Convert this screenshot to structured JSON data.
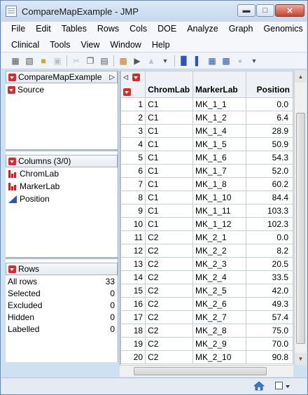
{
  "window": {
    "title": "CompareMapExample - JMP"
  },
  "menus": {
    "row1": [
      "File",
      "Edit",
      "Tables",
      "Rows",
      "Cols",
      "DOE",
      "Analyze",
      "Graph",
      "Genomics"
    ],
    "row2": [
      "Clinical",
      "Tools",
      "View",
      "Window",
      "Help"
    ]
  },
  "toolbar": [
    "new-table-icon",
    "open-icon",
    "folder-icon",
    "save-icon",
    "cut-icon",
    "copy-icon",
    "paste-icon",
    "report-icon",
    "run-script-icon",
    "chart-icon",
    "dist-icon",
    "fit-icon",
    "bivariate-icon",
    "graph-icon",
    "multivariate-icon",
    "options-icon"
  ],
  "table_panel": {
    "table_name": "CompareMapExample",
    "source_label": "Source"
  },
  "columns_panel": {
    "header": "Columns (3/0)",
    "items": [
      {
        "name": "ChromLab",
        "type": "nominal"
      },
      {
        "name": "MarkerLab",
        "type": "nominal"
      },
      {
        "name": "Position",
        "type": "continuous"
      }
    ]
  },
  "rows_panel": {
    "header": "Rows",
    "stats": [
      {
        "label": "All rows",
        "value": "33"
      },
      {
        "label": "Selected",
        "value": "0"
      },
      {
        "label": "Excluded",
        "value": "0"
      },
      {
        "label": "Hidden",
        "value": "0"
      },
      {
        "label": "Labelled",
        "value": "0"
      }
    ]
  },
  "grid": {
    "columns": [
      "ChromLab",
      "MarkerLab",
      "Position"
    ],
    "rows": [
      [
        "1",
        "C1",
        "MK_1_1",
        "0.0"
      ],
      [
        "2",
        "C1",
        "MK_1_2",
        "6.4"
      ],
      [
        "3",
        "C1",
        "MK_1_4",
        "28.9"
      ],
      [
        "4",
        "C1",
        "MK_1_5",
        "50.9"
      ],
      [
        "5",
        "C1",
        "MK_1_6",
        "54.3"
      ],
      [
        "6",
        "C1",
        "MK_1_7",
        "52.0"
      ],
      [
        "7",
        "C1",
        "MK_1_8",
        "60.2"
      ],
      [
        "8",
        "C1",
        "MK_1_10",
        "84.4"
      ],
      [
        "9",
        "C1",
        "MK_1_11",
        "103.3"
      ],
      [
        "10",
        "C1",
        "MK_1_12",
        "102.3"
      ],
      [
        "11",
        "C2",
        "MK_2_1",
        "0.0"
      ],
      [
        "12",
        "C2",
        "MK_2_2",
        "8.2"
      ],
      [
        "13",
        "C2",
        "MK_2_3",
        "20.5"
      ],
      [
        "14",
        "C2",
        "MK_2_4",
        "33.5"
      ],
      [
        "15",
        "C2",
        "MK_2_5",
        "42.0"
      ],
      [
        "16",
        "C2",
        "MK_2_6",
        "49.3"
      ],
      [
        "17",
        "C2",
        "MK_2_7",
        "57.4"
      ],
      [
        "18",
        "C2",
        "MK_2_8",
        "75.0"
      ],
      [
        "19",
        "C2",
        "MK_2_9",
        "70.0"
      ],
      [
        "20",
        "C2",
        "MK_2_10",
        "90.8"
      ]
    ]
  },
  "colors": {
    "accent_red": "#d32d2d",
    "continuous_blue": "#2b55b8",
    "close_button": "#c6452e"
  }
}
